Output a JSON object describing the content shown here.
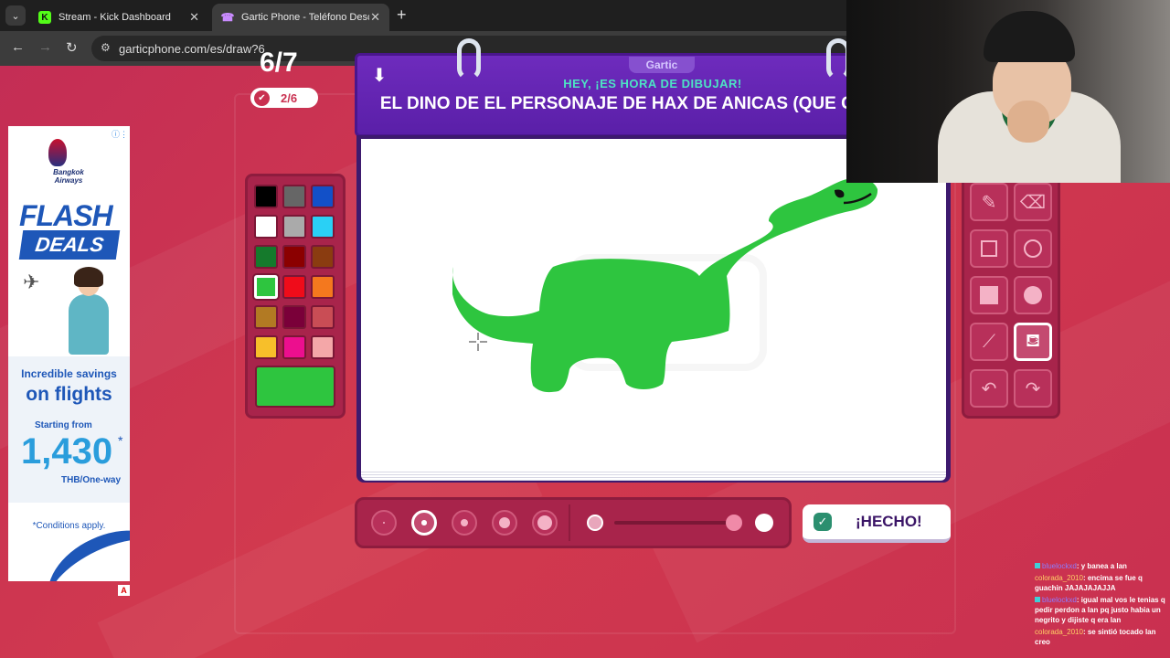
{
  "browser": {
    "tabs": [
      {
        "title": "Stream - Kick Dashboard",
        "icon": "kick-icon",
        "favicon_letter": "K",
        "active": false
      },
      {
        "title": "Gartic Phone - Teléfono Descon",
        "icon": "phone-icon",
        "favicon_glyph": "☎",
        "active": true
      }
    ],
    "url": "garticphone.com/es/draw?6",
    "new_tab_glyph": "+",
    "close_glyph": "✕",
    "menu_glyph": "⌄"
  },
  "ad": {
    "brand": "Bangkok Airways",
    "headline_1": "FLASH",
    "headline_2": "DEALS",
    "savings": "Incredible savings",
    "flights": "on flights",
    "from": "Starting from",
    "price": "1,430",
    "asterisk": "*",
    "unit": "THB/One-way",
    "conditions": "*Conditions apply.",
    "info_glyph": "ⓘ⋮",
    "ad_marker": "A"
  },
  "game": {
    "round": "6/7",
    "done_count": "2/6",
    "logo": "Gartic",
    "hey": "HEY, ¡ES HORA DE DIBUJAR!",
    "prompt": "EL DINO DE EL PERSONAJE DE HAX DE ANICAS (QUE COSAAAA",
    "done_label": "¡HECHO!"
  },
  "palette": {
    "colors": [
      "#000000",
      "#666666",
      "#1250c8",
      "#ffffff",
      "#aaaaaa",
      "#2ad0f5",
      "#157a2c",
      "#8b0000",
      "#8a3c10",
      "#2ec53f",
      "#ef0c1a",
      "#f4781e",
      "#b27a23",
      "#7a0039",
      "#c94d55",
      "#f7bf2a",
      "#ec0f8e",
      "#f4a7a8"
    ],
    "selected_index": 9,
    "current": "#2ec53f"
  },
  "tools": [
    {
      "name": "pencil-tool",
      "glyph": "✎"
    },
    {
      "name": "eraser-tool",
      "glyph": "⌫"
    },
    {
      "name": "rectangle-tool",
      "glyph": ""
    },
    {
      "name": "ellipse-tool",
      "glyph": ""
    },
    {
      "name": "filled-rectangle-tool",
      "glyph": ""
    },
    {
      "name": "filled-ellipse-tool",
      "glyph": ""
    },
    {
      "name": "line-tool",
      "glyph": "⟋"
    },
    {
      "name": "fill-bucket-tool",
      "glyph": "⛾",
      "active": true
    },
    {
      "name": "undo-tool",
      "glyph": "↶"
    },
    {
      "name": "redo-tool",
      "glyph": "↷"
    }
  ],
  "brush_sizes": {
    "selected_index": 1
  },
  "opacity": {
    "value": 0.9
  },
  "chat": [
    {
      "user": "bluelockxd",
      "text": ": y banea a lan"
    },
    {
      "user": "colorada_2010",
      "text": ": encima se fue q guachin JAJAJAJAJJA"
    },
    {
      "user": "bluelockxd",
      "text": ": igual mal vos le tenias q pedir perdon a lan pq justo habia un negrito y dijiste q era lan"
    },
    {
      "user": "colorada_2010",
      "text": ": se sintió tocado lan creo"
    }
  ]
}
